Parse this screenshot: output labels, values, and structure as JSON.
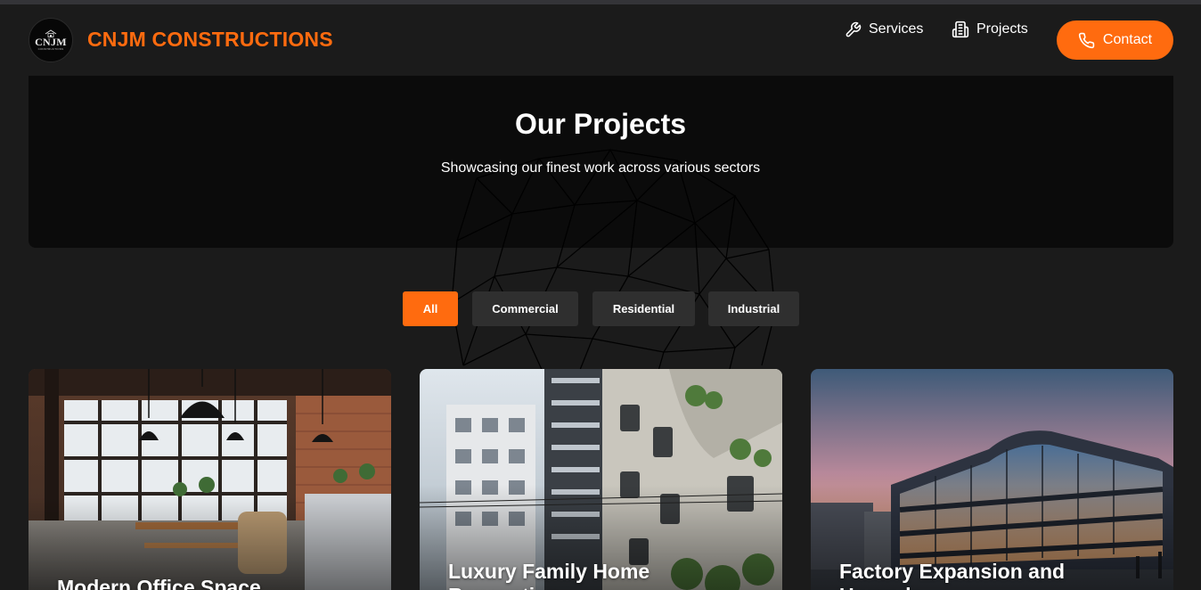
{
  "header": {
    "logo_text": "CNJM",
    "logo_subtext": "CONSTRUCTIONS",
    "brand": "CNJM CONSTRUCTIONS",
    "nav": [
      {
        "label": "Services",
        "icon": "wrench-icon"
      },
      {
        "label": "Projects",
        "icon": "building-icon"
      }
    ],
    "contact_label": "Contact",
    "contact_icon": "phone-icon"
  },
  "hero": {
    "title": "Our Projects",
    "subtitle": "Showcasing our finest work across various sectors"
  },
  "filters": [
    {
      "label": "All",
      "active": true
    },
    {
      "label": "Commercial",
      "active": false
    },
    {
      "label": "Residential",
      "active": false
    },
    {
      "label": "Industrial",
      "active": false
    }
  ],
  "projects": [
    {
      "title": "Modern Office Space"
    },
    {
      "title": "Luxury Family Home Renovation"
    },
    {
      "title": "Factory Expansion and Upgrade"
    }
  ],
  "colors": {
    "accent": "#ff6b0f",
    "background": "#1b1b1b",
    "hero_bg": "#0b0b0b",
    "filter_bg": "#2f2f2f"
  }
}
